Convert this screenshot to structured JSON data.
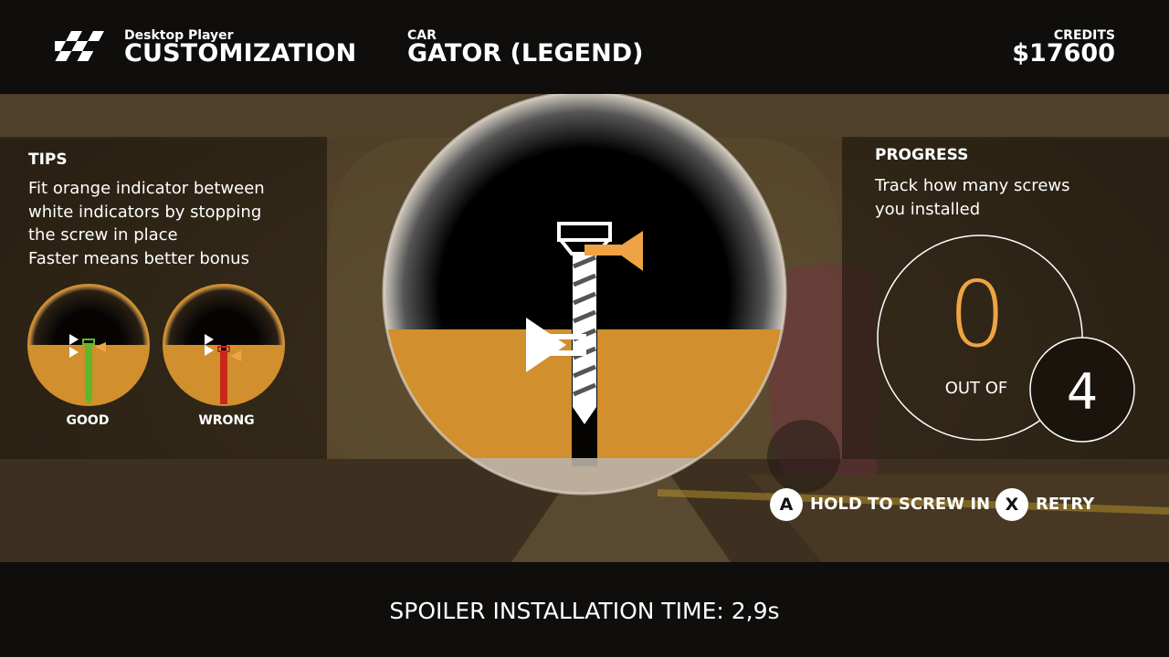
{
  "header": {
    "player_name": "Desktop Player",
    "screen_title": "CUSTOMIZATION",
    "car_label": "CAR",
    "car_name": "GATOR (LEGEND)",
    "credits_label": "CREDITS",
    "credits_value": "$17600"
  },
  "tips": {
    "title": "TIPS",
    "lines": [
      "Fit orange indicator between",
      "white indicators by stopping",
      "the screw in place",
      "Faster means better bonus"
    ],
    "examples": [
      {
        "label": "GOOD",
        "color": "#5fb82a"
      },
      {
        "label": "WRONG",
        "color": "#c8271c"
      }
    ]
  },
  "progress": {
    "title": "PROGRESS",
    "lines": [
      "Track how many screws",
      "you installed"
    ],
    "installed": "0",
    "out_of_label": "OUT OF",
    "total": "4"
  },
  "controls": [
    {
      "key": "A",
      "label": "HOLD TO SCREW IN"
    },
    {
      "key": "X",
      "label": "RETRY"
    }
  ],
  "footer": {
    "install_time": "SPOILER INSTALLATION TIME: 2,9s"
  },
  "colors": {
    "accent_orange": "#eea444",
    "wood": "#d18f2e",
    "bar_bg": "#0f0e0c"
  }
}
